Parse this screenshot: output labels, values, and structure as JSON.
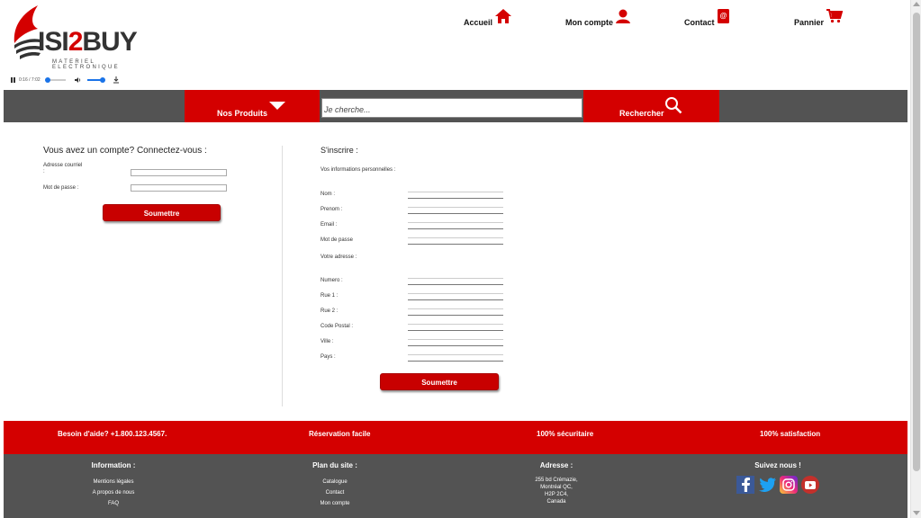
{
  "brand": {
    "logo_text_a": "ISI",
    "logo_text_b": "2",
    "logo_text_c": "BUY",
    "tagline": "MATERIEL ELECTRONIQUE",
    "accent": "#d40000",
    "dark": "#535353"
  },
  "audio": {
    "time": "0:16 / 7:02",
    "icon_play": "pause-icon",
    "icon_volume": "volume-icon",
    "icon_download": "download-icon"
  },
  "topnav": {
    "home": "Accueil",
    "account": "Mon compte",
    "contact": "Contact",
    "cart": "Pannier"
  },
  "searchbar": {
    "products": "Nos Produits",
    "placeholder": "Je cherche...",
    "search": "Rechercher"
  },
  "login": {
    "title": "Vous avez un compte? Connectez-vous :",
    "email_label": "Adresse courriel\n:",
    "password_label": "Mot de passe :",
    "submit": "Soumettre"
  },
  "register": {
    "title": "S'inscrire :",
    "personal_heading": "Vos informations personnelles :",
    "fields_personal": [
      "Nom :",
      "Prenom :",
      "Email :",
      "Mot de passe"
    ],
    "address_heading": "Votre adresse :",
    "fields_address": [
      "Numero :",
      "Rue 1 :",
      "Rue 2 :",
      "Code Postal :",
      "Ville :",
      "Pays :"
    ],
    "submit": "Soumettre"
  },
  "strip": {
    "help": "Besoin d'aide? +1.800.123.4567.",
    "reservation": "Réservation facile",
    "secure": "100% sécuritaire",
    "satisfaction": "100% satisfaction"
  },
  "footer": {
    "info_title": "Information :",
    "info_links": [
      "Mentions légales",
      "A propos de nous",
      "FAQ"
    ],
    "plan_title": "Plan du site :",
    "plan_links": [
      "Catalogue",
      "Contact",
      "Mon compte"
    ],
    "address_title": "Adresse :",
    "address_lines": [
      "255 bd Crémazie,",
      "Montréal QC,",
      "H2P 2C4,",
      "Canada"
    ],
    "social_title": "Suivez nous !",
    "social_icons": [
      "facebook-icon",
      "twitter-icon",
      "instagram-icon",
      "youtube-icon"
    ]
  }
}
